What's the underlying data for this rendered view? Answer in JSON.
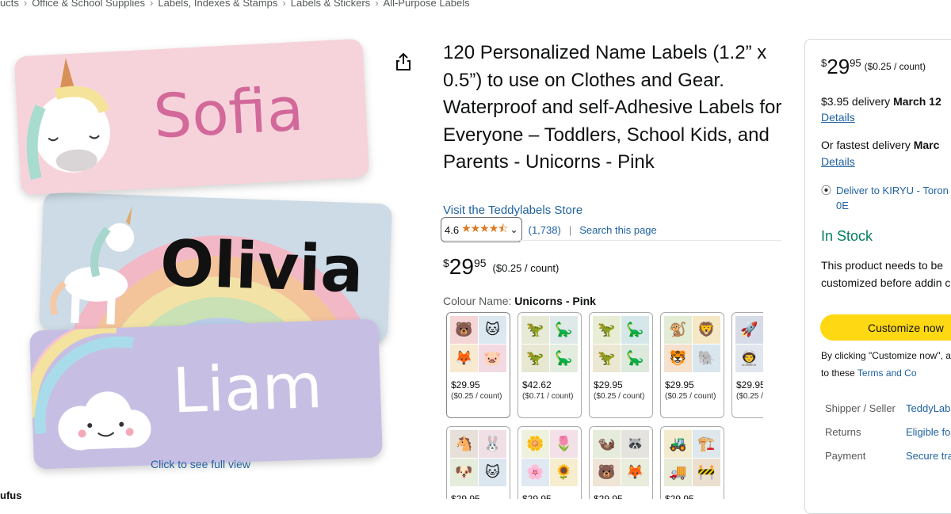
{
  "breadcrumb": [
    "ucts",
    "Office & School Supplies",
    "Labels, Indexes & Stamps",
    "Labels & Stickers",
    "All-Purpose Labels"
  ],
  "image": {
    "names": [
      "Sofia",
      "Olivia",
      "Liam"
    ],
    "click_full_view": "Click to see full view",
    "bottom_text": "ufus"
  },
  "product": {
    "title": "120 Personalized Name Labels (1.2” x 0.5”) to use on Clothes and Gear. Waterproof and self-Adhesive Labels for Everyone – Toddlers, School Kids, and Parents - Unicorns - Pink",
    "store_link": "Visit the Teddylabels Store",
    "rating": "4.6",
    "stars": "★★★★⯪",
    "rating_count": "(1,738)",
    "search_page": "Search this page",
    "price_symbol": "$",
    "price_whole": "29",
    "price_fraction": "95",
    "price_unit": "($0.25 / count)",
    "colour_label": "Colour Name:",
    "colour_value": "Unicorns - Pink"
  },
  "swatches": [
    {
      "price": "$29.95",
      "unit": "($0.25 / count)",
      "icons": [
        "🐻",
        "🐱",
        "🦊",
        "🐷"
      ],
      "bgs": [
        "#f5d6d6",
        "#dce8f0",
        "#f7ead0",
        "#f3d9e2"
      ]
    },
    {
      "price": "$42.62",
      "unit": "($0.71 / count)",
      "icons": [
        "🦖",
        "🦕",
        "🦖",
        "🦕"
      ],
      "bgs": [
        "#e6ead6",
        "#dfe9e9",
        "#e7e7d2",
        "#e3ecdf"
      ]
    },
    {
      "price": "$29.95",
      "unit": "($0.25 / count)",
      "icons": [
        "🦖",
        "🦕",
        "🦖",
        "🦕"
      ],
      "bgs": [
        "#e8edd6",
        "#d6e7ea",
        "#ece7d3",
        "#dde9dc"
      ]
    },
    {
      "price": "$29.95",
      "unit": "($0.25 / count)",
      "icons": [
        "🐒",
        "🦁",
        "🐯",
        "🐘"
      ],
      "bgs": [
        "#e3ecd5",
        "#f4e8c5",
        "#f5e1cd",
        "#d9e6ee"
      ]
    },
    {
      "price": "$29.95",
      "unit": "($0.25 / count)",
      "icons": [
        "🚀",
        "🌙",
        "👨‍🚀",
        "🪐"
      ],
      "bgs": [
        "#d6dbe8",
        "#dde6ee",
        "#e1e6ee",
        "#e4e1ee"
      ]
    },
    {
      "price": "$29.95",
      "unit": "",
      "icons": [
        "🐴",
        "🐰",
        "🐶",
        "🐱"
      ],
      "bgs": [
        "#e6e0d8",
        "#f1dfe6",
        "#e4ecdb",
        "#dbe6ee"
      ]
    },
    {
      "price": "$29.95",
      "unit": "",
      "icons": [
        "🌼",
        "🌷",
        "🌸",
        "🌻"
      ],
      "bgs": [
        "#eef2dc",
        "#f4e0e7",
        "#e0e8f2",
        "#f7eed0"
      ]
    },
    {
      "price": "$29.95",
      "unit": "",
      "icons": [
        "🦦",
        "🦝",
        "🐻",
        "🦊"
      ],
      "bgs": [
        "#e5ecdc",
        "#e5e3de",
        "#efe5d6",
        "#e9eddc"
      ]
    },
    {
      "price": "$29.95",
      "unit": "",
      "icons": [
        "🚜",
        "🏗️",
        "🚚",
        "🚧"
      ],
      "bgs": [
        "#f3ebcd",
        "#dde7ec",
        "#e8ebd8",
        "#ecdfcf"
      ]
    }
  ],
  "buybox": {
    "price_symbol": "$",
    "price_whole": "29",
    "price_fraction": "95",
    "price_unit": "($0.25 / count)",
    "delivery": "$3.95 delivery",
    "delivery_date": "March 12",
    "details": "Details",
    "fastest": "Or fastest delivery",
    "fastest_date": "Marc",
    "details2": "Details",
    "deliver_to": "Deliver to KIRYU - Toron 0E",
    "in_stock": "In Stock",
    "custom_note": "This product needs to be customized before addin cart.",
    "customize_button": "Customize now",
    "consent_prefix": "By clicking \"Customize now\", agree to these",
    "consent_link": "Terms and Co",
    "rows": [
      {
        "key": "Shipper / Seller",
        "value": "TeddyLab"
      },
      {
        "key": "Returns",
        "value": "Eligible fo"
      },
      {
        "key": "Payment",
        "value": "Secure tra"
      }
    ]
  }
}
